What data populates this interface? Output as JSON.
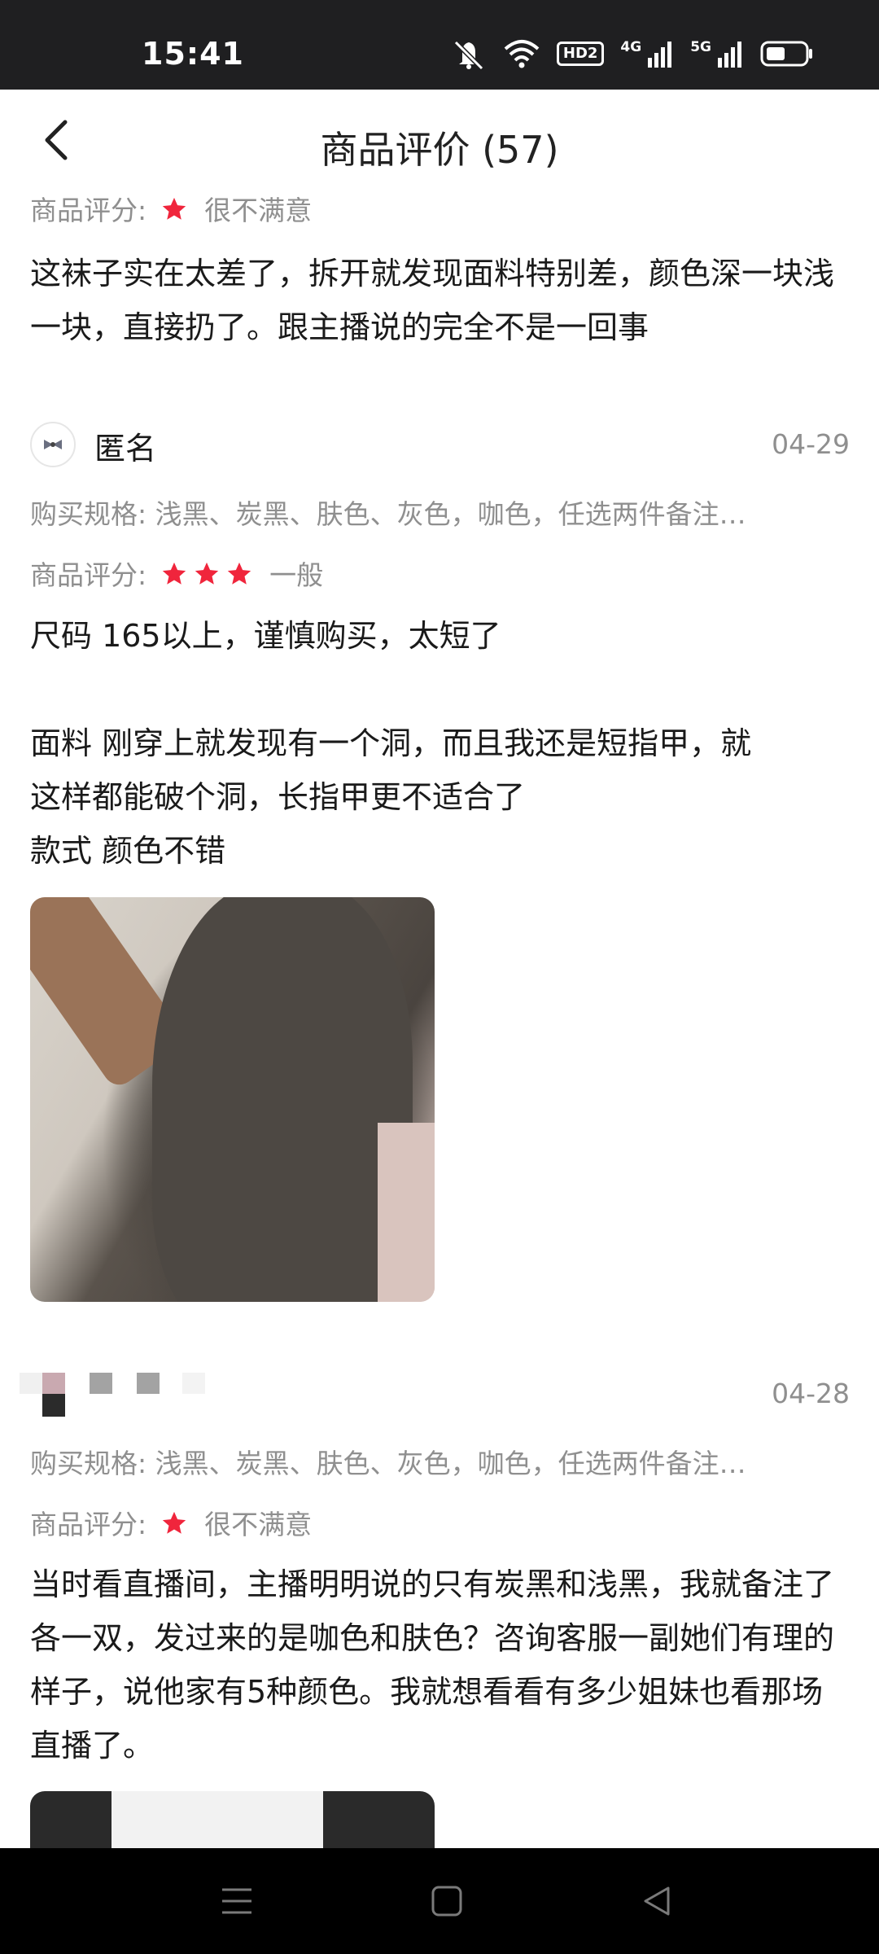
{
  "status_bar": {
    "time": "15:41",
    "icons": [
      "mute-icon",
      "wifi-icon",
      "hd-icon",
      "signal-4g-icon",
      "signal-5g-icon",
      "battery-icon"
    ],
    "hd_label": "HD2",
    "net_4g": "4G",
    "net_5g": "5G"
  },
  "header": {
    "title": "商品评价 (57)"
  },
  "labels": {
    "rating": "商品评分:",
    "spec": "购买规格:"
  },
  "reviews": [
    {
      "rating_stars": 1,
      "rating_text": "很不满意",
      "text": "这袜子实在太差了，拆开就发现面料特别差，颜色深一块浅一块，直接扔了。跟主播说的完全不是一回事"
    },
    {
      "user": "匿名",
      "date": "04-29",
      "spec": "浅黑、炭黑、肤色、灰色，咖色，任选两件备注…",
      "rating_stars": 3,
      "rating_text": "一般",
      "text_lines": [
        "尺码 165以上，谨慎购买，太短了",
        "",
        "面料 刚穿上就发现有一个洞，而且我还是短指甲，就",
        "这样都能破个洞，长指甲更不适合了",
        "款式 颜色不错"
      ]
    },
    {
      "date": "04-28",
      "spec": "浅黑、炭黑、肤色、灰色，咖色，任选两件备注…",
      "rating_stars": 1,
      "rating_text": "很不满意",
      "text": "当时看直播间，主播明明说的只有炭黑和浅黑，我就备注了各一双，发过来的是咖色和肤色？咨询客服一副她们有理的样子，说他家有5种颜色。我就想看看有多少姐妹也看那场直播了。"
    }
  ],
  "colors": {
    "star": "#f0253c",
    "status_bg": "#1f1f21",
    "meta_gray": "#8f8f8f"
  },
  "nav": {
    "icons": [
      "menu-icon",
      "home-icon",
      "back-triangle-icon"
    ]
  }
}
